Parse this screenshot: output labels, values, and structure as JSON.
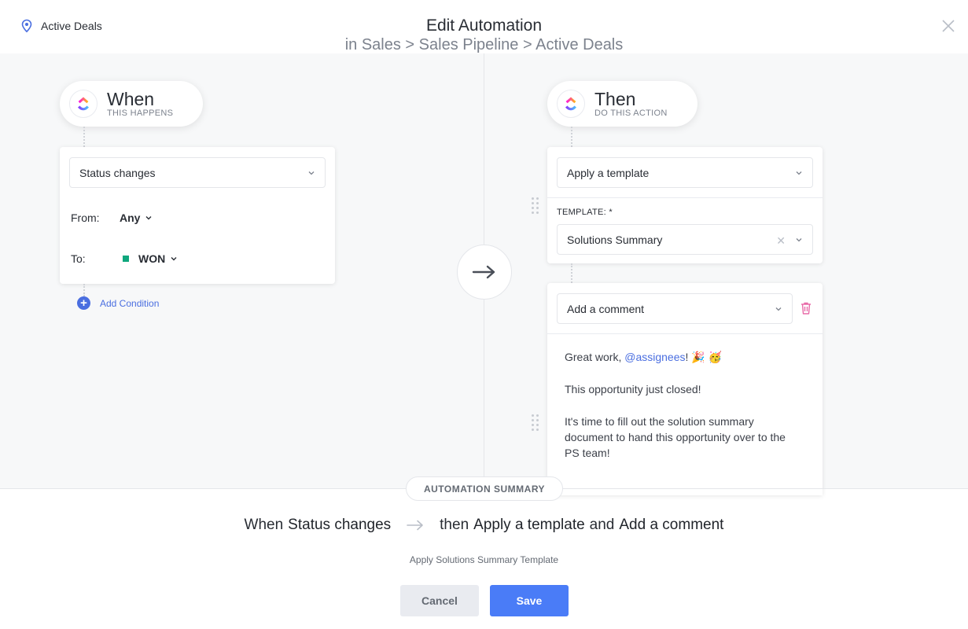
{
  "header": {
    "location": "Active Deals",
    "title": "Edit Automation",
    "subtitle": "in Sales > Sales Pipeline > Active Deals"
  },
  "when": {
    "title": "When",
    "subtitle": "THIS HAPPENS",
    "trigger": "Status changes",
    "from_label": "From:",
    "from_value": "Any",
    "to_label": "To:",
    "to_value": "WON",
    "to_color": "#0fa77d",
    "add_condition": "Add Condition"
  },
  "then": {
    "title": "Then",
    "subtitle": "DO THIS ACTION",
    "action1": "Apply a template",
    "template_label": "TEMPLATE: *",
    "template_value": "Solutions Summary",
    "action2": "Add a comment",
    "comment": {
      "greeting_pre": "Great work, ",
      "mention": "@assignees",
      "greeting_post": "! 🎉 🥳",
      "line2": "This opportunity just closed!",
      "line3": "It's time to fill out the solution summary document to hand this opportunity over to the PS team!"
    }
  },
  "summary": {
    "label": "AUTOMATION SUMMARY",
    "when": "When",
    "trigger": "Status changes",
    "then": "then",
    "action1": "Apply a template",
    "and": "and",
    "action2": "Add a comment",
    "sub": "Apply Solutions Summary Template"
  },
  "buttons": {
    "cancel": "Cancel",
    "save": "Save"
  },
  "colors": {
    "accent": "#4a7cf7",
    "link": "#4a6ee0",
    "trash": "#e86ba8"
  }
}
